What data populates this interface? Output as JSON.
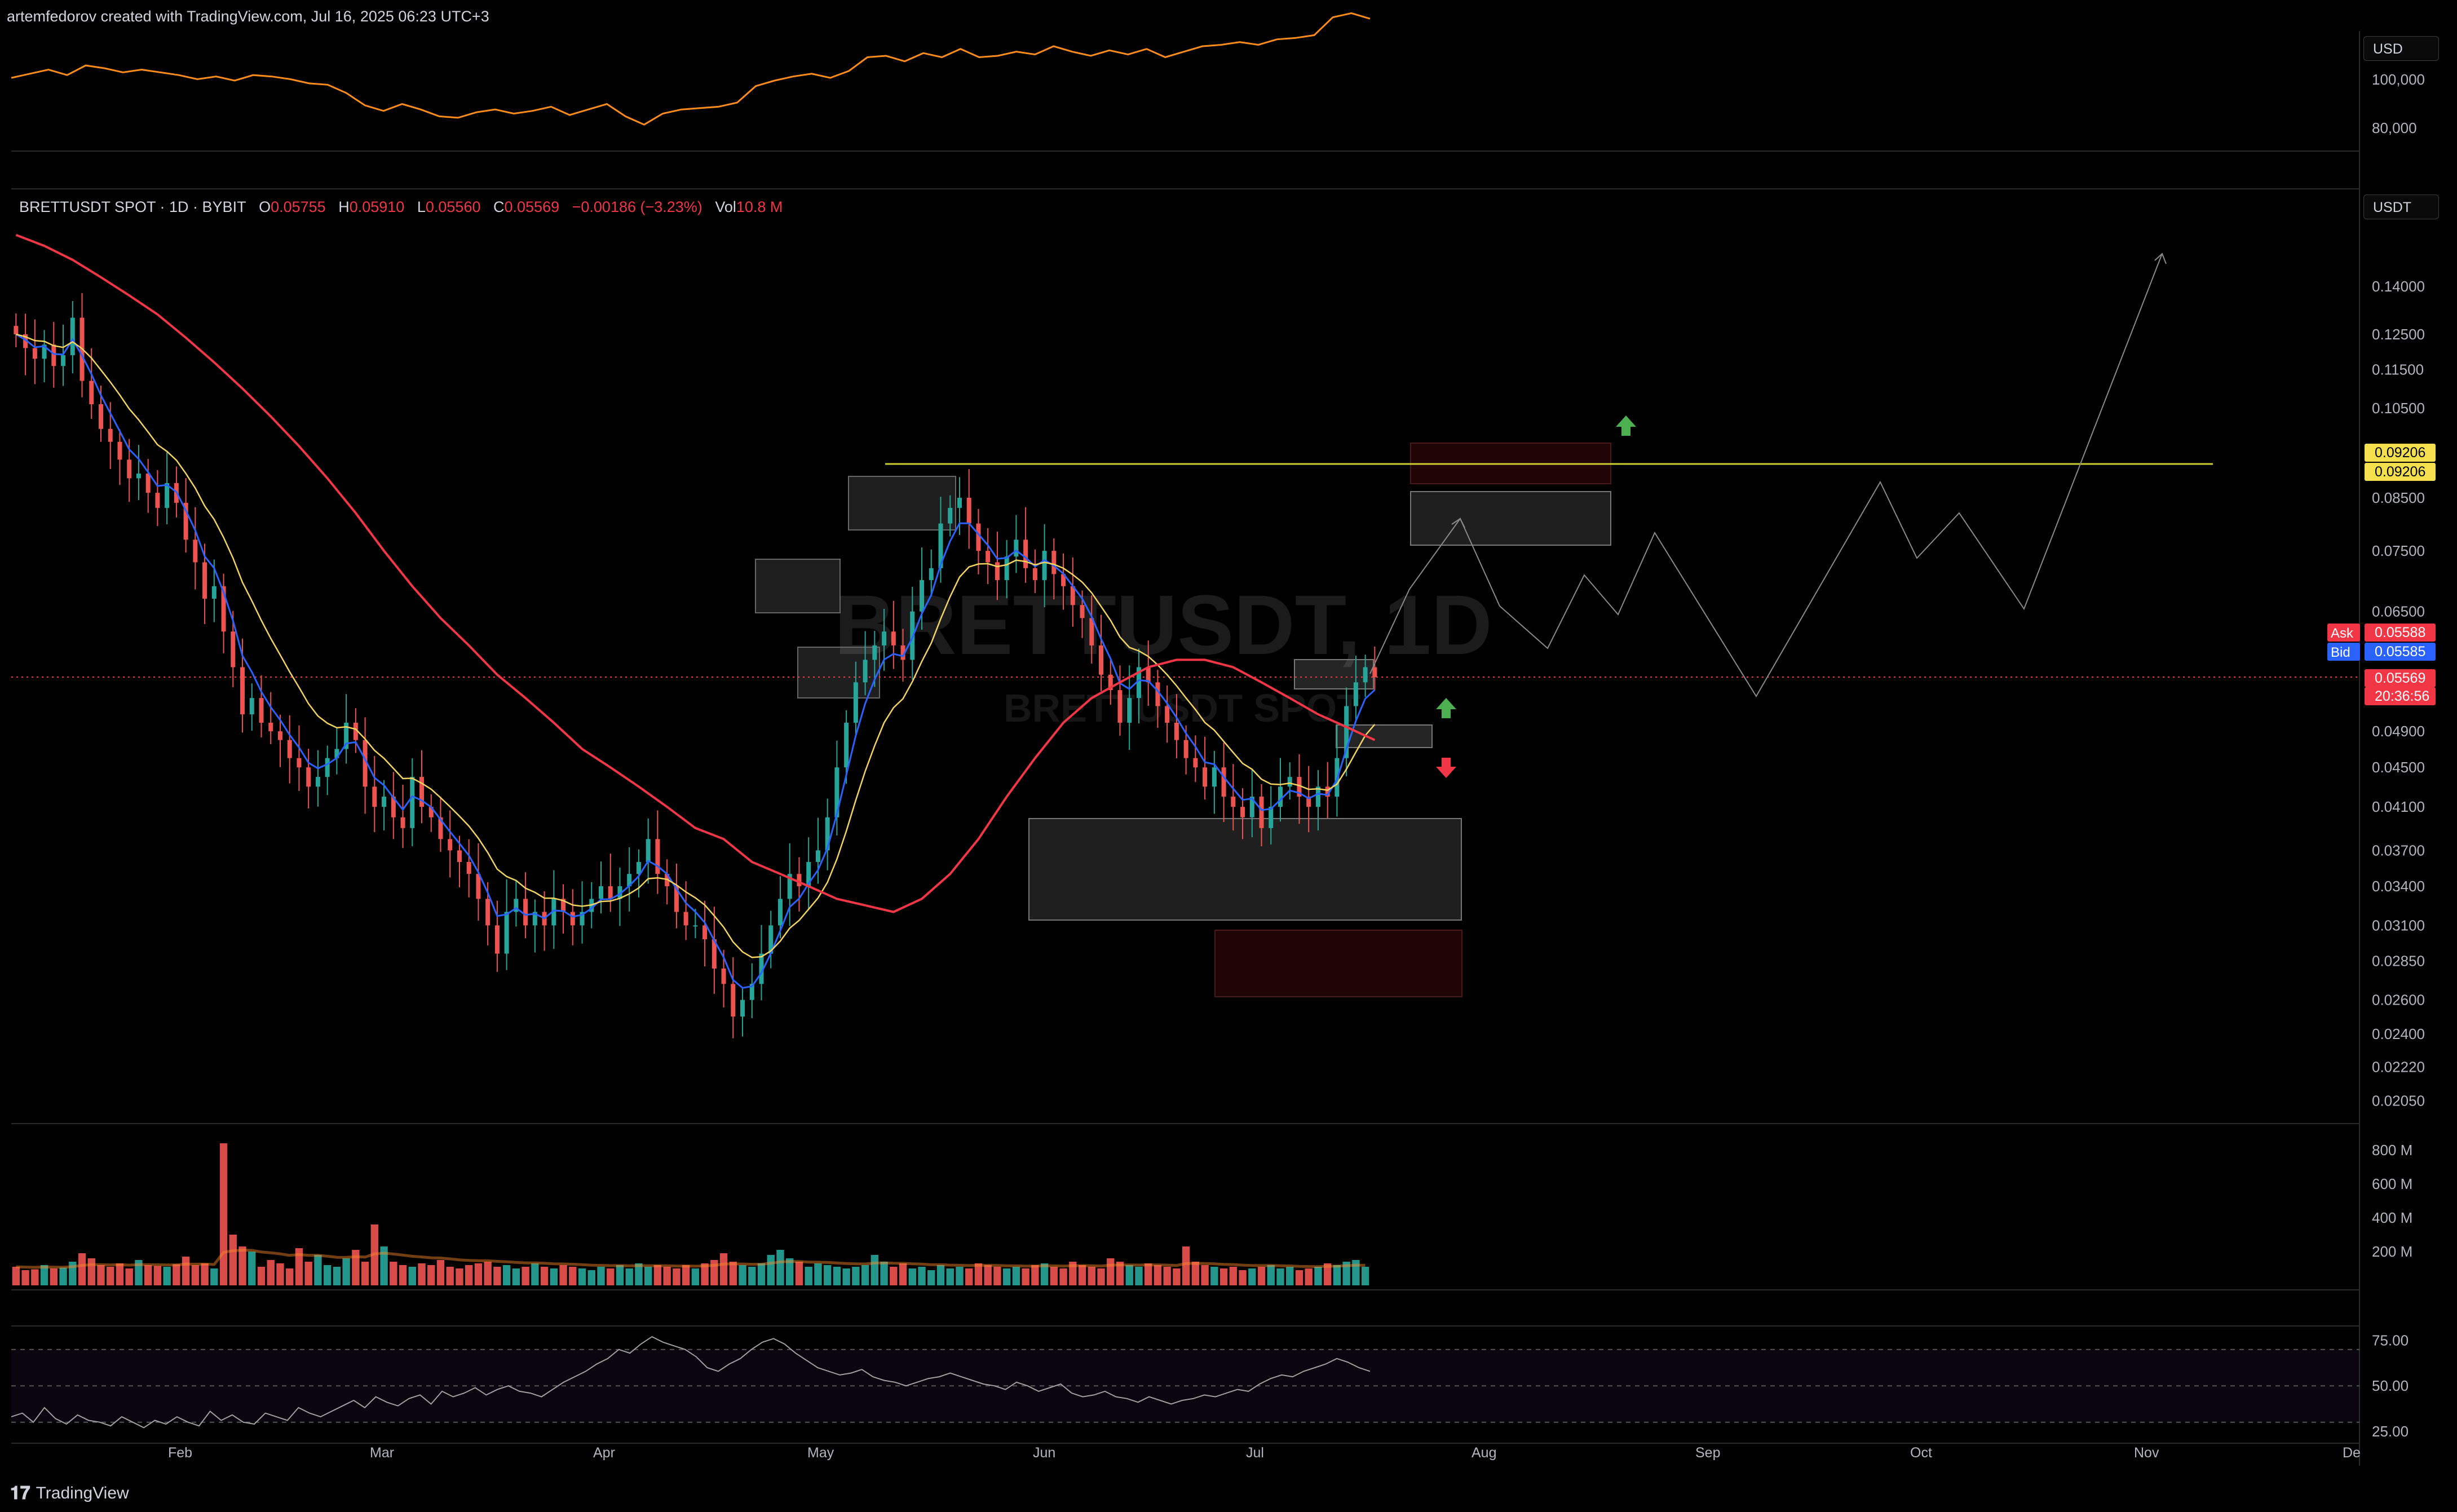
{
  "header": {
    "text": "artemfedorov created with TradingView.com, Jul 16, 2025 06:23 UTC+3"
  },
  "top_panel": {
    "currency": "USD",
    "ticks": [
      "100,000",
      "80,000"
    ]
  },
  "main_panel": {
    "currency": "USDT",
    "legend": {
      "symbol": "BRETTUSDT SPOT · 1D · BYBIT",
      "o_label": "O",
      "o": "0.05755",
      "h_label": "H",
      "h": "0.05910",
      "l_label": "L",
      "l": "0.05560",
      "c_label": "C",
      "c": "0.05569",
      "change": "−0.00186 (−3.23%)",
      "vol_label": "Vol",
      "vol": "10.8 M"
    },
    "watermark": {
      "title": "BRETTUSDT, 1D",
      "subtitle": "BRETTUSDT SPOT"
    }
  },
  "price_tags": {
    "level_top": "0.09206",
    "level_bottom": "0.09206",
    "ask_label": "Ask",
    "ask": "0.05588",
    "bid_label": "Bid",
    "bid": "0.05585",
    "last": "0.05569",
    "countdown": "20:36:56"
  },
  "footer": {
    "logo_text": "TradingView"
  },
  "colors": {
    "bg": "#000000",
    "up": "#26a69a",
    "down": "#ef5350",
    "ema_fast": "#2962ff",
    "ema_mid": "#f4d35e",
    "ema_slow": "#f23645",
    "level": "#cccc33",
    "btc": "#ff8c1a"
  },
  "chart_data": [
    {
      "type": "line",
      "name_hidden": true,
      "ylim": [
        70000,
        112000
      ],
      "y_ticks": [
        "100,000",
        "80,000"
      ],
      "values": [
        96000,
        97500,
        99000,
        97000,
        100500,
        99500,
        98000,
        99000,
        98000,
        97000,
        95500,
        96500,
        95000,
        97000,
        96500,
        95500,
        94000,
        93500,
        90500,
        86000,
        84000,
        86500,
        84500,
        82000,
        81500,
        83500,
        84500,
        83000,
        84000,
        85500,
        82500,
        84500,
        86500,
        82000,
        79000,
        83000,
        84500,
        85000,
        85500,
        87000,
        93000,
        95000,
        96500,
        97500,
        96000,
        98500,
        103500,
        104000,
        102000,
        105000,
        103500,
        106500,
        103500,
        104000,
        105500,
        104500,
        107500,
        105500,
        104000,
        106000,
        104500,
        106500,
        103500,
        105500,
        107500,
        108000,
        109000,
        108000,
        110000,
        110500,
        111500,
        118000,
        119500,
        117500
      ]
    },
    {
      "type": "candlestick",
      "period": "1D",
      "scale": "log",
      "x_ticks": [
        "Feb",
        "Mar",
        "Apr",
        "May",
        "Jun",
        "Jul",
        "Aug",
        "Sep",
        "Oct",
        "Nov",
        "De"
      ],
      "y_ticks": [
        "0.14000",
        "0.12500",
        "0.11500",
        "0.10500",
        "0.08500",
        "0.07500",
        "0.06500",
        "0.04900",
        "0.04500",
        "0.04100",
        "0.03700",
        "0.03400",
        "0.03100",
        "0.02850",
        "0.02600",
        "0.02400",
        "0.02220",
        "0.02050"
      ],
      "close": [
        0.125,
        0.121,
        0.118,
        0.122,
        0.116,
        0.119,
        0.13,
        0.112,
        0.106,
        0.1,
        0.097,
        0.093,
        0.089,
        0.09,
        0.086,
        0.083,
        0.088,
        0.084,
        0.077,
        0.073,
        0.067,
        0.069,
        0.062,
        0.057,
        0.051,
        0.053,
        0.05,
        0.049,
        0.048,
        0.046,
        0.045,
        0.043,
        0.044,
        0.046,
        0.047,
        0.05,
        0.048,
        0.043,
        0.041,
        0.042,
        0.04,
        0.039,
        0.044,
        0.041,
        0.04,
        0.038,
        0.037,
        0.036,
        0.035,
        0.033,
        0.031,
        0.029,
        0.032,
        0.033,
        0.031,
        0.032,
        0.031,
        0.033,
        0.032,
        0.031,
        0.032,
        0.033,
        0.034,
        0.033,
        0.034,
        0.035,
        0.036,
        0.038,
        0.035,
        0.034,
        0.032,
        0.031,
        0.031,
        0.03,
        0.028,
        0.027,
        0.025,
        0.026,
        0.027,
        0.029,
        0.031,
        0.033,
        0.035,
        0.034,
        0.036,
        0.037,
        0.04,
        0.045,
        0.05,
        0.055,
        0.058,
        0.06,
        0.062,
        0.06,
        0.058,
        0.065,
        0.07,
        0.072,
        0.08,
        0.083,
        0.085,
        0.08,
        0.075,
        0.073,
        0.07,
        0.074,
        0.077,
        0.072,
        0.07,
        0.075,
        0.071,
        0.069,
        0.066,
        0.064,
        0.06,
        0.056,
        0.054,
        0.05,
        0.053,
        0.057,
        0.055,
        0.052,
        0.05,
        0.048,
        0.046,
        0.045,
        0.043,
        0.045,
        0.042,
        0.041,
        0.04,
        0.042,
        0.039,
        0.041,
        0.043,
        0.044,
        0.042,
        0.041,
        0.043,
        0.042,
        0.046,
        0.052,
        0.055,
        0.057,
        0.05569
      ],
      "ema_slow": [
        0.158,
        0.154,
        0.149,
        0.143,
        0.137,
        0.131,
        0.124,
        0.117,
        0.11,
        0.103,
        0.096,
        0.089,
        0.082,
        0.075,
        0.069,
        0.064,
        0.06,
        0.056,
        0.053,
        0.05,
        0.047,
        0.045,
        0.043,
        0.041,
        0.039,
        0.038,
        0.036,
        0.035,
        0.034,
        0.033,
        0.0325,
        0.032,
        0.033,
        0.035,
        0.038,
        0.042,
        0.046,
        0.05,
        0.053,
        0.055,
        0.057,
        0.058,
        0.058,
        0.057,
        0.055,
        0.053,
        0.051,
        0.0495,
        0.048
      ],
      "levels": [
        {
          "price": 0.09206,
          "kind": "horizontal"
        }
      ]
    },
    {
      "type": "bar",
      "name_hidden": true,
      "y_ticks": [
        "800 M",
        "600 M",
        "400 M",
        "200 M"
      ],
      "ylim": [
        0,
        900
      ],
      "values": [
        110,
        90,
        95,
        120,
        100,
        105,
        140,
        190,
        160,
        120,
        110,
        130,
        100,
        150,
        120,
        115,
        110,
        125,
        170,
        120,
        130,
        100,
        840,
        300,
        230,
        200,
        110,
        150,
        130,
        100,
        220,
        140,
        180,
        120,
        110,
        160,
        210,
        140,
        360,
        230,
        140,
        120,
        110,
        130,
        120,
        150,
        110,
        100,
        120,
        130,
        140,
        110,
        120,
        100,
        110,
        130,
        110,
        100,
        120,
        110,
        100,
        90,
        110,
        100,
        120,
        100,
        130,
        110,
        120,
        110,
        100,
        120,
        100,
        130,
        150,
        190,
        140,
        120,
        110,
        130,
        180,
        210,
        160,
        140,
        110,
        130,
        120,
        110,
        100,
        110,
        120,
        180,
        140,
        110,
        130,
        100,
        110,
        90,
        120,
        100,
        110,
        100,
        130,
        120,
        110,
        100,
        110,
        100,
        120,
        130,
        110,
        100,
        140,
        120,
        110,
        100,
        160,
        140,
        120,
        110,
        130,
        120,
        110,
        100,
        230,
        140,
        120,
        110,
        100,
        110,
        90,
        100,
        110,
        120,
        100,
        110,
        90,
        100,
        110,
        130,
        120,
        140,
        150,
        110
      ]
    },
    {
      "type": "line",
      "name_hidden": true,
      "ylim": [
        20,
        82
      ],
      "y_ticks": [
        "75.00",
        "50.00",
        "25.00"
      ],
      "values": [
        33,
        35,
        30,
        38,
        32,
        29,
        34,
        31,
        30,
        28,
        33,
        30,
        27,
        31,
        29,
        33,
        30,
        28,
        36,
        31,
        34,
        30,
        29,
        35,
        33,
        31,
        38,
        35,
        33,
        36,
        39,
        42,
        38,
        44,
        41,
        39,
        43,
        45,
        40,
        47,
        44,
        46,
        49,
        45,
        48,
        50,
        47,
        46,
        44,
        48,
        52,
        55,
        58,
        62,
        65,
        70,
        68,
        73,
        77,
        74,
        72,
        70,
        66,
        60,
        58,
        62,
        65,
        70,
        74,
        76,
        73,
        68,
        64,
        60,
        58,
        56,
        57,
        59,
        55,
        53,
        52,
        50,
        52,
        54,
        55,
        57,
        55,
        53,
        51,
        50,
        48,
        52,
        50,
        47,
        49,
        51,
        46,
        44,
        45,
        47,
        44,
        43,
        41,
        44,
        42,
        40,
        42,
        43,
        45,
        44,
        46,
        48,
        47,
        51,
        54,
        56,
        55,
        58,
        60,
        62,
        65,
        63,
        60,
        58
      ]
    }
  ]
}
